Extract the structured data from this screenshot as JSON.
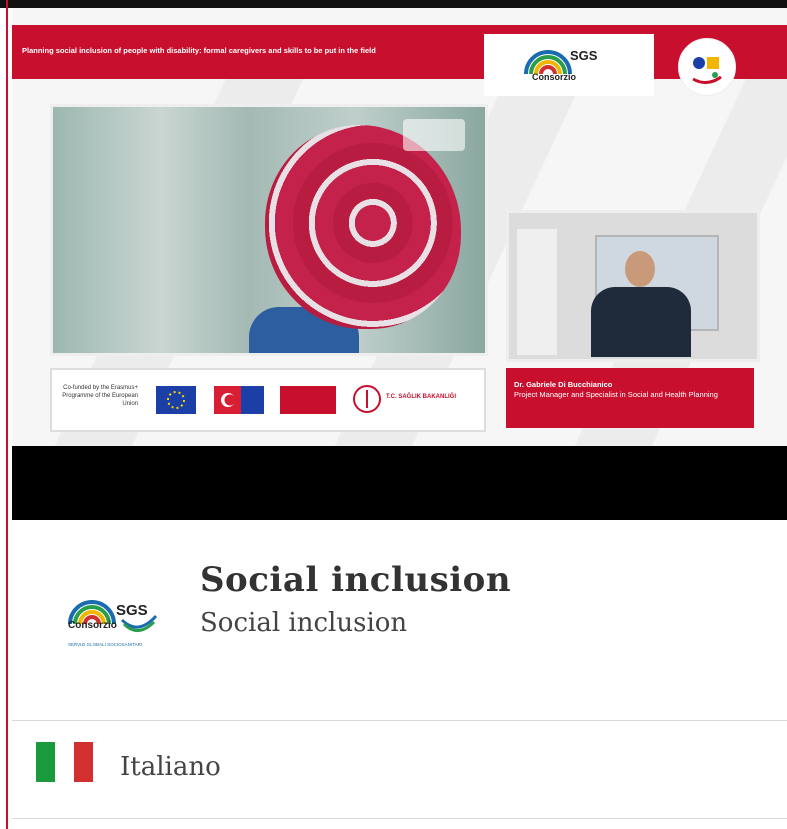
{
  "video": {
    "banner_text": "Planning social inclusion of people with disability: formal caregivers and skills to be put in the field",
    "cofunded_text": "Co-funded by the Erasmus+ Programme of the European Union",
    "saglik_text": "T.C. SAĞLIK BAKANLIĞI",
    "speaker_name": "Dr. Gabriele Di Bucchianico",
    "speaker_role": "Project Manager and Specialist in Social and Health Planning"
  },
  "logo": {
    "sgs": "SGS",
    "consorzio": "Consorzio",
    "tagline": "SERVIZI GLOBALI SOCIOSANITARI"
  },
  "course": {
    "title": "Social inclusion",
    "subtitle": "Social inclusion"
  },
  "language": {
    "label": "Italiano",
    "flag_colors": [
      "#1a9a3c",
      "#ffffff",
      "#d32f2f"
    ]
  },
  "colors": {
    "accent": "#c8102e"
  }
}
